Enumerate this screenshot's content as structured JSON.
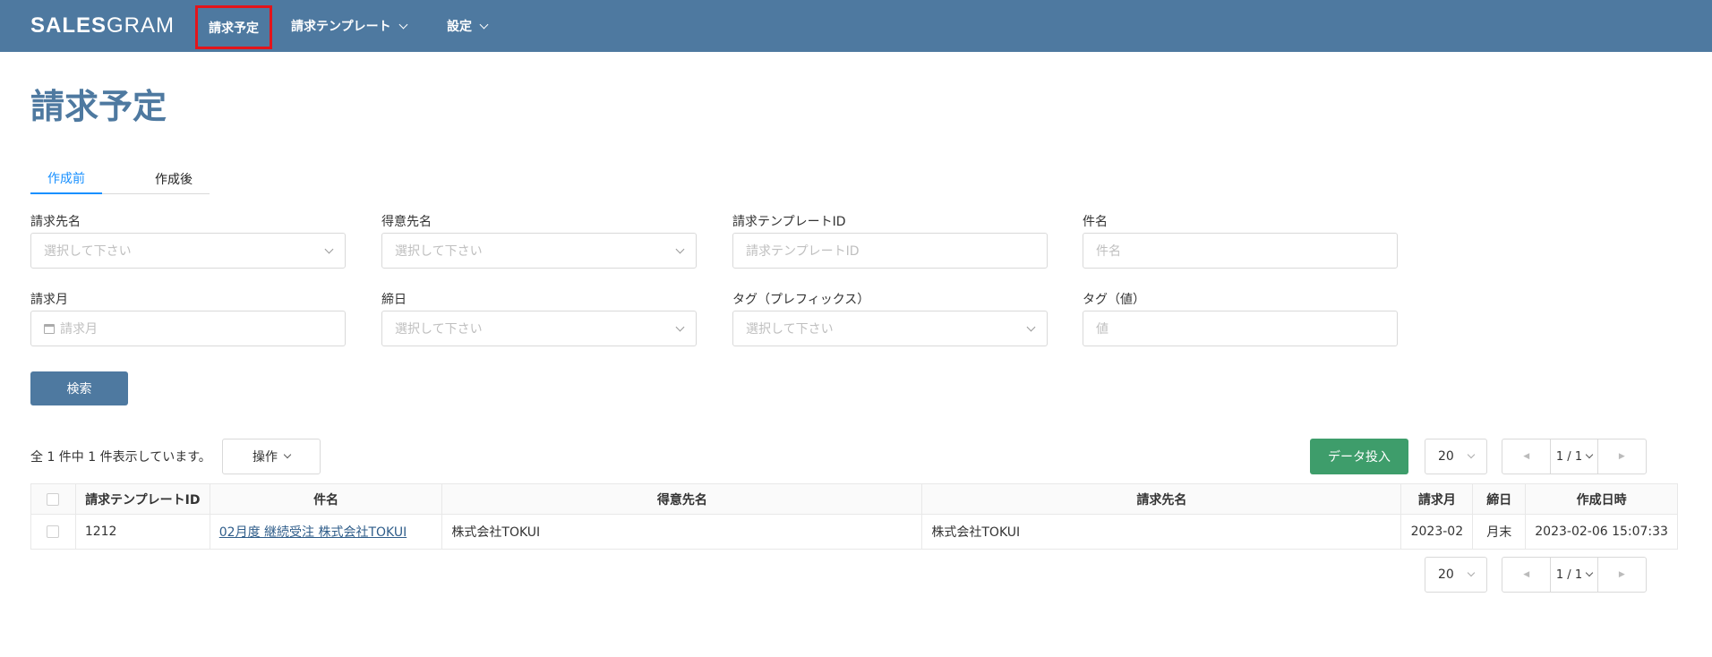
{
  "header": {
    "logo_bold": "SALES",
    "logo_light": "GRAM",
    "nav": [
      {
        "label": "請求予定"
      },
      {
        "label": "請求テンプレート"
      },
      {
        "label": "設定"
      }
    ]
  },
  "page": {
    "title": "請求予定",
    "tabs": [
      {
        "label": "作成前"
      },
      {
        "label": "作成後"
      }
    ]
  },
  "form": {
    "billing_to": {
      "label": "請求先名",
      "placeholder": "選択して下さい"
    },
    "customer": {
      "label": "得意先名",
      "placeholder": "選択して下さい"
    },
    "template_id": {
      "label": "請求テンプレートID",
      "placeholder": "請求テンプレートID"
    },
    "subject": {
      "label": "件名",
      "placeholder": "件名"
    },
    "billing_month": {
      "label": "請求月",
      "placeholder": "請求月"
    },
    "closing_day": {
      "label": "締日",
      "placeholder": "選択して下さい"
    },
    "tag_prefix": {
      "label": "タグ（プレフィックス）",
      "placeholder": "選択して下さい"
    },
    "tag_value": {
      "label": "タグ（値）",
      "placeholder": "値"
    },
    "search_button": "検索"
  },
  "results": {
    "count_text": "全 1 件中 1 件表示しています。",
    "ops_button": "操作",
    "import_button": "データ投入",
    "page_size": "20",
    "page_indicator": "1 / 1",
    "columns": [
      "請求テンプレートID",
      "件名",
      "得意先名",
      "請求先名",
      "請求月",
      "締日",
      "作成日時"
    ],
    "rows": [
      {
        "template_id": "1212",
        "subject": "02月度 継続受注 株式会社TOKUI",
        "customer": "株式会社TOKUI",
        "billing_to": "株式会社TOKUI",
        "month": "2023-02",
        "closing": "月末",
        "created": "2023-02-06 15:07:33"
      }
    ]
  },
  "colors": {
    "header": "#4e79a0",
    "active_tab": "#1890ff",
    "import_button": "#3e9d6b",
    "highlight": "#e3141b"
  }
}
